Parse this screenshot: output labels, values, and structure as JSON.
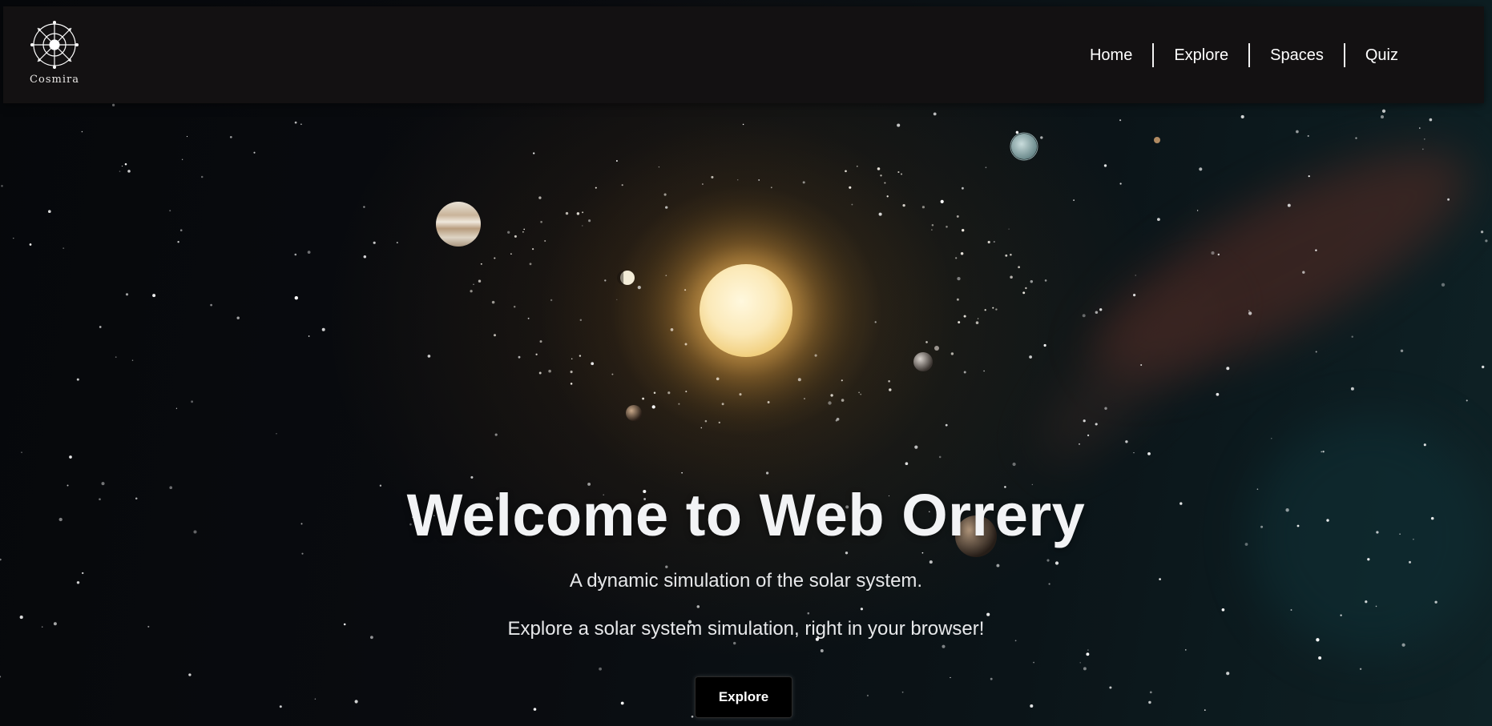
{
  "brand": {
    "name": "Cosmira",
    "logo_icon": "compass-rose-icon"
  },
  "nav": {
    "items": [
      {
        "label": "Home"
      },
      {
        "label": "Explore"
      },
      {
        "label": "Spaces"
      },
      {
        "label": "Quiz"
      }
    ]
  },
  "hero": {
    "title": "Welcome to Web Orrery",
    "subtitle": "A dynamic simulation of the solar system.",
    "tagline": "Explore a solar system simulation, right in your browser!",
    "button_label": "Explore",
    "background_image": "solar-system-illustration"
  },
  "colors": {
    "navbar_bg": "#131112",
    "nav_text": "#ffffff",
    "title_text": "#f2f3f5",
    "button_bg": "#000000",
    "sun": "#fbe9b8"
  }
}
